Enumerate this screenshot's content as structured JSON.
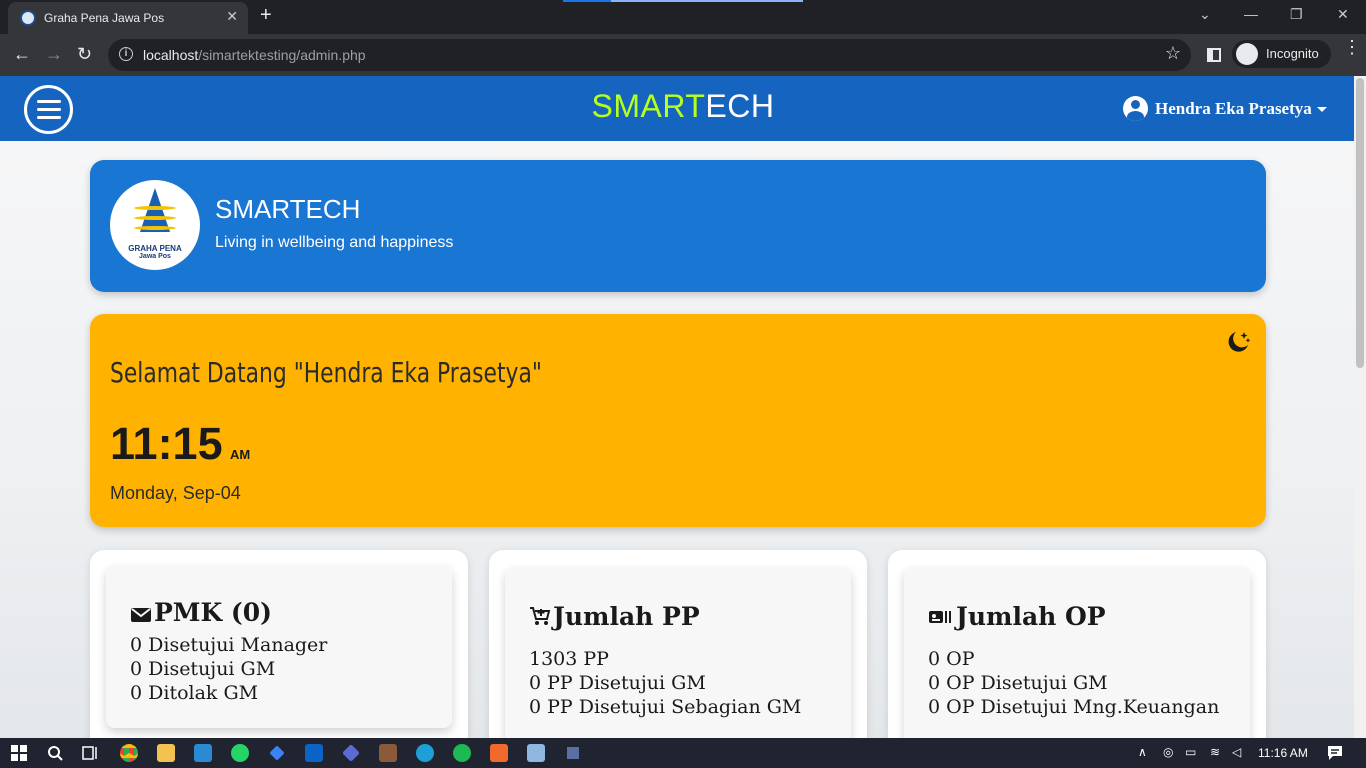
{
  "browser": {
    "tab_title": "Graha Pena Jawa Pos",
    "url_host": "localhost",
    "url_path": "/simartektesting/admin.php",
    "incognito_label": "Incognito"
  },
  "appbar": {
    "brand_accent": "SMART",
    "brand_rest": "ECH",
    "brand_accent_color": "#b7ff1c",
    "bar_color": "#1565c0",
    "user_name": "Hendra Eka Prasetya"
  },
  "hero": {
    "logo_text_1": "GRAHA PENA",
    "logo_text_2": "Jawa Pos",
    "title": "SMARTECH",
    "subtitle": "Living in wellbeing and happiness",
    "color": "#1976d2"
  },
  "welcome": {
    "greeting": "Selamat Datang \"Hendra Eka Prasetya\"",
    "time": "11:15",
    "ampm": "AM",
    "date": "Monday, Sep-04",
    "icon": "moon-stars-icon",
    "color": "#ffb300"
  },
  "cards": [
    {
      "title": "PMK (0)",
      "icon": "mail-icon",
      "lines": [
        "0 Disetujui Manager",
        "0 Disetujui GM",
        "0 Ditolak GM"
      ]
    },
    {
      "title": "Jumlah PP",
      "icon": "cart-add-icon",
      "lines": [
        "1303 PP",
        "0 PP Disetujui GM",
        "0 PP Disetujui Sebagian GM"
      ]
    },
    {
      "title": "Jumlah OP",
      "icon": "receipt-icon",
      "lines": [
        "0 OP",
        "0 OP Disetujui GM",
        "0 OP Disetujui Mng.Keuangan"
      ]
    }
  ],
  "taskbar": {
    "time": "11:16 AM"
  }
}
